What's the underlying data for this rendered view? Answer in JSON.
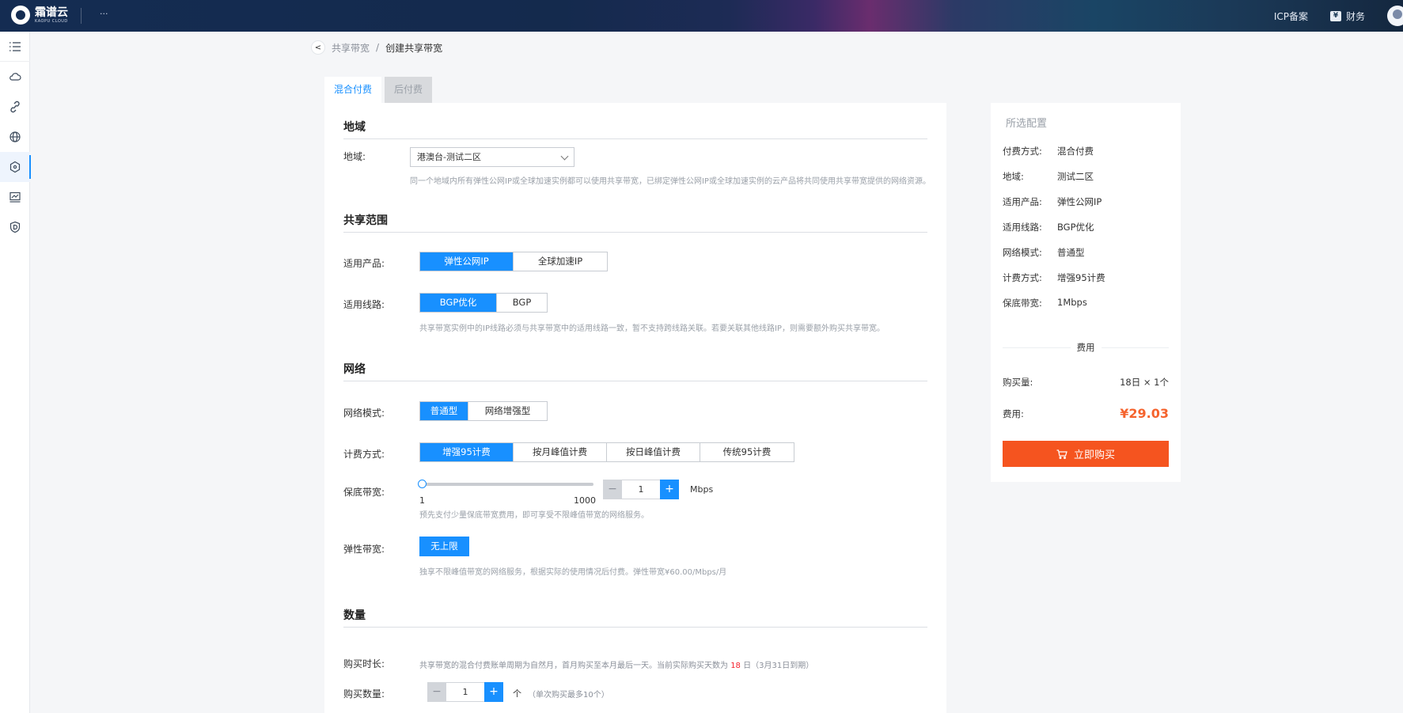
{
  "topbar": {
    "logo_cn": "霜谱云",
    "logo_en": "KAOPU CLOUD",
    "more": "···",
    "icp_label": "ICP备案",
    "finance_label": "财务",
    "finance_icon_glyph": "¥"
  },
  "sidebar": {
    "items": [
      "menu-icon",
      "cloud-icon",
      "link-icon",
      "globe-icon",
      "network-icon",
      "monitor-icon",
      "shield-icon"
    ],
    "active_index": 4
  },
  "breadcrumb": {
    "back": "<",
    "parent": "共享带宽",
    "separator": "/",
    "current": "创建共享带宽"
  },
  "tabs": [
    {
      "label": "混合付费",
      "active": true
    },
    {
      "label": "后付费",
      "active": false
    }
  ],
  "form": {
    "region_section": "地域",
    "region_label": "地域:",
    "region_value": "港澳台-测试二区",
    "region_hint": "同一个地域内所有弹性公网IP或全球加速实例都可以使用共享带宽，已绑定弹性公网IP或全球加速实例的云产品将共同使用共享带宽提供的网络资源。",
    "scope_section": "共享范围",
    "product_label": "适用产品:",
    "product_options": [
      "弹性公网IP",
      "全球加速IP"
    ],
    "product_selected": 0,
    "line_label": "适用线路:",
    "line_options": [
      "BGP优化",
      "BGP"
    ],
    "line_selected": 0,
    "line_hint": "共享带宽实例中的IP线路必须与共享带宽中的适用线路一致，暂不支持跨线路关联。若要关联其他线路IP，则需要额外购买共享带宽。",
    "network_section": "网络",
    "mode_label": "网络模式:",
    "mode_options": [
      "普通型",
      "网络增强型"
    ],
    "mode_selected": 0,
    "billing_label": "计费方式:",
    "billing_options": [
      "增强95计费",
      "按月峰值计费",
      "按日峰值计费",
      "传统95计费"
    ],
    "billing_selected": 0,
    "guarantee_label": "保底带宽:",
    "slider_min": "1",
    "slider_max": "1000",
    "slider_value": 1,
    "guarantee_value": "1",
    "guarantee_unit": "Mbps",
    "guarantee_hint": "预先支付少量保底带宽费用，即可享受不限峰值带宽的网络服务。",
    "elastic_label": "弹性带宽:",
    "elastic_button": "无上限",
    "elastic_hint": "独享不限峰值带宽的网络服务，根据实际的使用情况后付费。弹性带宽¥60.00/Mbps/月",
    "quantity_section": "数量",
    "duration_label": "购买时长:",
    "duration_hint_pre": "共享带宽的混合付费账单周期为自然月，首月购买至本月最后一天。当前实际购买天数为",
    "duration_days": "18",
    "duration_hint_post": "日（3月31日到期）",
    "count_label": "购买数量:",
    "count_value": "1",
    "count_unit": "个",
    "count_hint": "（单次购买最多10个）",
    "minus": "−",
    "plus": "+"
  },
  "summary": {
    "title": "所选配置",
    "rows": [
      {
        "key": "付费方式:",
        "value": "混合付费"
      },
      {
        "key": "地域:",
        "value": "测试二区"
      },
      {
        "key": "适用产品:",
        "value": "弹性公网IP"
      },
      {
        "key": "适用线路:",
        "value": "BGP优化"
      },
      {
        "key": "网络模式:",
        "value": "普通型"
      },
      {
        "key": "计费方式:",
        "value": "增强95计费"
      },
      {
        "key": "保底带宽:",
        "value": "1Mbps"
      }
    ],
    "fee_section": "费用",
    "qty_label": "购买量:",
    "qty_value": "18日 × 1个",
    "fee_label": "费用:",
    "fee_value": "¥29.03",
    "buy_button": "立即购买"
  },
  "colors": {
    "accent": "#1890ff",
    "buy": "#f5541f",
    "price": "#f5632d"
  }
}
